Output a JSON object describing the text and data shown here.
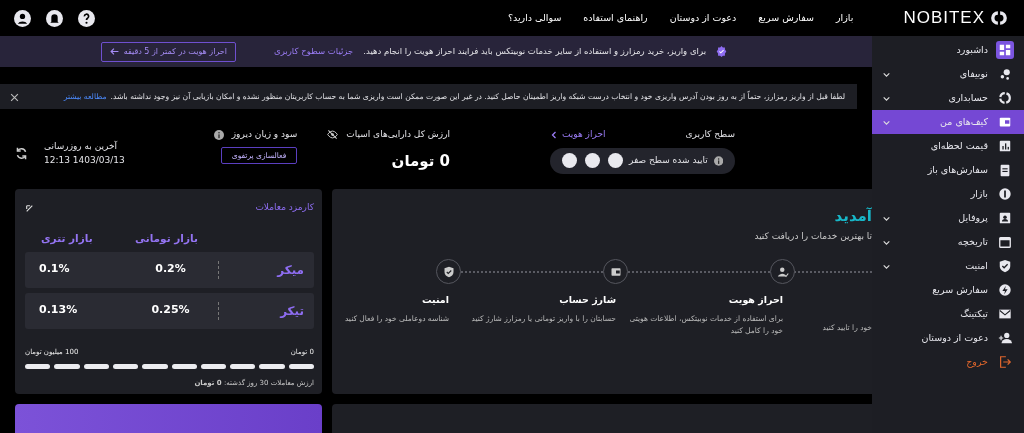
{
  "navbar": {
    "logo": "NOBITEX",
    "links": [
      "بازار",
      "سفارش سریع",
      "دعوت از دوستان",
      "راهنمای استفاده",
      "سوالی دارید؟"
    ]
  },
  "kyc_banner": {
    "text": "برای واریز، خرید رمزارز و استفاده از سایر خدمات نوبیتکس باید فرایند احراز هویت را انجام دهید.",
    "link": "جزئیات سطوح کاربری",
    "button": "احراز هویت در کمتر از 5 دقیقه"
  },
  "notice": {
    "text": "لطفا قبل از واریز رمزارز، حتماً از به روز بودن آدرس واریزی خود و انتخاب درست شبکه واریز اطمینان حاصل کنید. در غیر این صورت ممکن است واریزی شما به حساب کاربریتان منظور نشده و امکان بازیابی آن نیز وجود نداشته باشد.",
    "link": "مطالعه بیشتر"
  },
  "stats": {
    "user_level": {
      "label": "سطح کاربری",
      "link": "احراز هویت",
      "status": "تایید شده سطح صفر"
    },
    "spot_value": {
      "label": "ارزش کل دارایی‌های اسپات",
      "value": "0 تومان"
    },
    "pnl": {
      "label": "سود و زیان دیروز",
      "button": "فعالسازی پرتفوی"
    },
    "update": {
      "label": "آخرین به روزرسانی",
      "time": "12:13 1403/03/13"
    }
  },
  "welcome": {
    "title": "آمدید",
    "subtitle": "تا بهترین خدمات را دریافت کنید",
    "partial_step_text": "خود را تایید کنید",
    "steps": [
      {
        "title": "احراز هویت",
        "text": "برای استفاده از خدمات نوبیتکس، اطلاعات هویتی خود را کامل کنید"
      },
      {
        "title": "شارژ حساب",
        "text": "حسابتان را با واریز تومانی یا رمزارز شارژ کنید"
      },
      {
        "title": "امنیت",
        "text": "شناسه دوعاملی خود را فعال کنید"
      }
    ]
  },
  "fees": {
    "title": "کارمزد معاملات",
    "columns": [
      "بازار تومانی",
      "بازار تتری"
    ],
    "rows": [
      {
        "label": "میکر",
        "values": [
          "0.2%",
          "0.1%"
        ]
      },
      {
        "label": "تیکر",
        "values": [
          "0.25%",
          "0.13%"
        ]
      }
    ],
    "range_start": "0 تومان",
    "range_end": "100 میلیون تومان",
    "volume": "ارزش معاملات 30 روز گذشته: **0 تومان**"
  },
  "sidebar": {
    "items": [
      {
        "label": "داشبورد",
        "kind": "link",
        "current": true,
        "expandable": false,
        "selected": false
      },
      {
        "label": "نوبیفای",
        "kind": "link",
        "current": false,
        "expandable": true,
        "selected": false
      },
      {
        "label": "حسابداری",
        "kind": "link",
        "current": false,
        "expandable": true,
        "selected": false
      },
      {
        "label": "کیف‌های من",
        "kind": "link",
        "current": false,
        "expandable": true,
        "selected": true
      },
      {
        "label": "قیمت لحظه‌ای",
        "kind": "link",
        "current": false,
        "expandable": false,
        "selected": false
      },
      {
        "label": "سفارش‌های باز",
        "kind": "link",
        "current": false,
        "expandable": false,
        "selected": false
      },
      {
        "label": "بازار",
        "kind": "link",
        "current": false,
        "expandable": false,
        "selected": false
      },
      {
        "label": "پروفایل",
        "kind": "link",
        "current": false,
        "expandable": true,
        "selected": false
      },
      {
        "label": "تاریخچه",
        "kind": "link",
        "current": false,
        "expandable": true,
        "selected": false
      },
      {
        "label": "امنیت",
        "kind": "link",
        "current": false,
        "expandable": true,
        "selected": false
      },
      {
        "label": "سفارش سریع",
        "kind": "link",
        "current": false,
        "expandable": false,
        "selected": false
      },
      {
        "label": "تیکتینگ",
        "kind": "link",
        "current": false,
        "expandable": false,
        "selected": false
      },
      {
        "label": "دعوت از دوستان",
        "kind": "link",
        "current": false,
        "expandable": false,
        "selected": false
      },
      {
        "label": "خروج",
        "kind": "logout",
        "current": false,
        "expandable": false,
        "selected": false
      }
    ]
  }
}
